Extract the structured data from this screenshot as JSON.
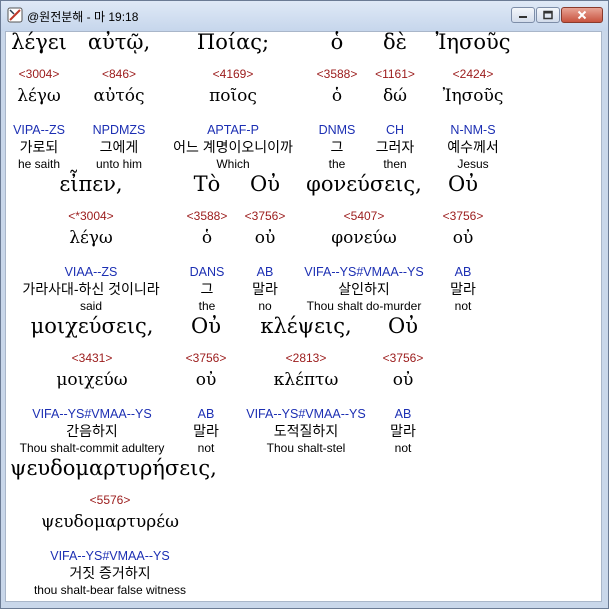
{
  "window": {
    "title": "@원전분해 - 마 19:18",
    "app_icon": "app-logo-icon",
    "controls": [
      "minimize-icon",
      "maximize-icon",
      "close-icon"
    ]
  },
  "words": [
    {
      "greek": "λέγει",
      "num": "<3004>",
      "lemma": "λέγω",
      "parse": "VIPA--ZS",
      "ko": "가로되",
      "en": "he saith"
    },
    {
      "greek": "αὐτῷ,",
      "num": "<846>",
      "lemma": "αὐτός",
      "parse": "NPDMZS",
      "ko": "그에게",
      "en": "unto him"
    },
    {
      "greek": "Ποίας;",
      "num": "<4169>",
      "lemma": "ποῖος",
      "parse": "APTAF-P",
      "ko": "어느 계명이오니이까",
      "en": "Which"
    },
    {
      "greek": "ὁ",
      "num": "<3588>",
      "lemma": "ὁ",
      "parse": "DNMS",
      "ko": "그",
      "en": "the"
    },
    {
      "greek": "δὲ",
      "num": "<1161>",
      "lemma": "δώ",
      "parse": "CH",
      "ko": "그러자",
      "en": "then"
    },
    {
      "greek": "Ἰησοῦς",
      "num": "<2424>",
      "lemma": "Ἰησοῦς",
      "parse": "N-NM-S",
      "ko": "예수께서",
      "en": "Jesus"
    },
    {
      "greek": "εἶπεν,",
      "num": "<*3004>",
      "lemma": "λέγω",
      "parse": "VIAA--ZS",
      "ko": "가라사대-하신 것이니라",
      "en": "said"
    },
    {
      "greek": "Τὸ",
      "num": "<3588>",
      "lemma": "ὁ",
      "parse": "DANS",
      "ko": "그",
      "en": "the"
    },
    {
      "greek": "Οὐ",
      "num": "<3756>",
      "lemma": "οὐ",
      "parse": "AB",
      "ko": "말라",
      "en": "no"
    },
    {
      "greek": "φονεύσεις,",
      "num": "<5407>",
      "lemma": "φονεύω",
      "parse": "VIFA--YS#VMAA--YS",
      "ko": "살인하지",
      "en": "Thou shalt do-murder"
    },
    {
      "greek": "Οὐ",
      "num": "<3756>",
      "lemma": "οὐ",
      "parse": "AB",
      "ko": "말라",
      "en": "not"
    },
    {
      "greek": "μοιχεύσεις,",
      "num": "<3431>",
      "lemma": "μοιχεύω",
      "parse": "VIFA--YS#VMAA--YS",
      "ko": "간음하지",
      "en": "Thou shalt-commit adultery"
    },
    {
      "greek": "Οὐ",
      "num": "<3756>",
      "lemma": "οὐ",
      "parse": "AB",
      "ko": "말라",
      "en": "not"
    },
    {
      "greek": "κλέψεις,",
      "num": "<2813>",
      "lemma": "κλέπτω",
      "parse": "VIFA--YS#VMAA--YS",
      "ko": "도적질하지",
      "en": "Thou shalt-stel"
    },
    {
      "greek": "Οὐ",
      "num": "<3756>",
      "lemma": "οὐ",
      "parse": "AB",
      "ko": "말라",
      "en": "not"
    },
    {
      "greek": "ψευδομαρτυρήσεις,",
      "num": "<5576>",
      "lemma": "ψευδομαρτυρέω",
      "parse": "VIFA--YS#VMAA--YS",
      "ko": "거짓 증거하지",
      "en": "thou shalt-bear false witness"
    }
  ]
}
